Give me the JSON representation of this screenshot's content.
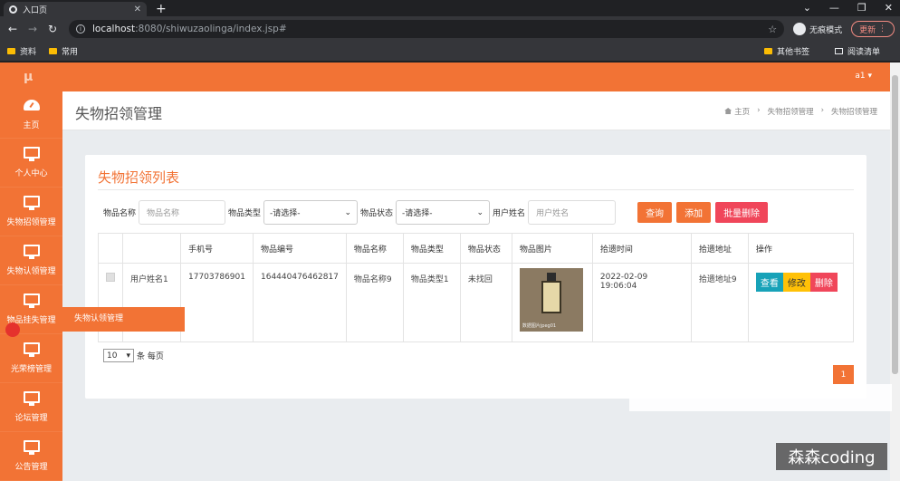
{
  "browser": {
    "tab_title": "入口页",
    "tab_close": "✕",
    "new_tab": "+",
    "window_controls": [
      "⌄",
      "—",
      "❐",
      "✕"
    ],
    "url_host": "localhost",
    "url_path": ":8080/shiwuzaolinga/index.jsp#",
    "incognito_label": "无痕模式",
    "update_label": "更新",
    "bookmarks": [
      "资料",
      "常用"
    ],
    "bookmarks_right": [
      "其他书签",
      "阅读清单"
    ]
  },
  "app": {
    "logo": "μ",
    "user": "a1 ▾",
    "page_title": "失物招领管理",
    "breadcrumb": [
      "主页",
      "›",
      "失物招领管理",
      "›",
      "失物招领管理"
    ]
  },
  "sidebar": {
    "items": [
      {
        "label": "主页",
        "icon": "dashboard-icon"
      },
      {
        "label": "个人中心",
        "icon": "monitor-icon"
      },
      {
        "label": "失物招领管理",
        "icon": "monitor-icon"
      },
      {
        "label": "失物认领管理",
        "icon": "monitor-icon"
      },
      {
        "label": "物品挂失管理",
        "icon": "monitor-icon"
      },
      {
        "label": "光荣榜管理",
        "icon": "monitor-icon"
      },
      {
        "label": "论坛管理",
        "icon": "monitor-icon"
      },
      {
        "label": "公告管理",
        "icon": "monitor-icon"
      }
    ],
    "flyout": "失物认领管理"
  },
  "card": {
    "title": "失物招领列表",
    "search": {
      "name_label": "物品名称",
      "name_placeholder": "物品名称",
      "type_label": "物品类型",
      "type_value": "-请选择-",
      "status_label": "物品状态",
      "status_value": "-请选择-",
      "user_label": "用户姓名",
      "user_placeholder": "用户姓名",
      "query": "查询",
      "add": "添加",
      "batch_delete": "批量删除"
    },
    "table": {
      "headers": [
        "",
        "",
        "手机号",
        "物品编号",
        "物品名称",
        "物品类型",
        "物品状态",
        "物品图片",
        "拾遗时间",
        "拾遗地址",
        "操作"
      ],
      "rows": [
        {
          "user": "用户姓名1",
          "phone": "17703786901",
          "item_no": "164440476462817",
          "item_name": "物品名称9",
          "item_type": "物品类型1",
          "status": "未找回",
          "image_caption": "数据图片jpeg01",
          "time": "2022-02-09 19:06:04",
          "address": "拾遗地址9",
          "actions": [
            "查看",
            "修改",
            "删除"
          ]
        }
      ]
    },
    "page_size": "10",
    "page_size_suffix": "条 每页",
    "current_page": "1"
  },
  "watermark": "森森coding",
  "colors": {
    "primary": "#f27335",
    "danger": "#f0465a",
    "info": "#17a2b8",
    "warning": "#ffc107"
  }
}
